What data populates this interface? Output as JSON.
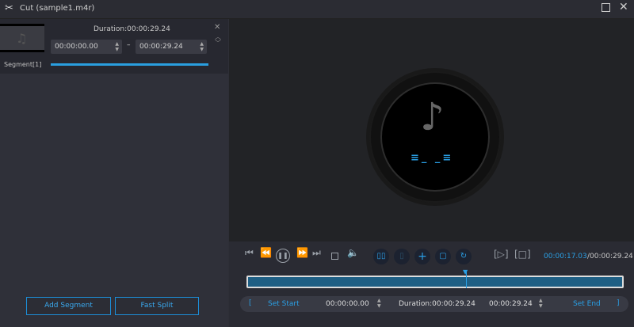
{
  "window": {
    "title": "Cut (sample1.m4r)"
  },
  "segment": {
    "duration": "Duration:00:00:29.24",
    "start": "00:00:00.00",
    "end": "00:00:29.24",
    "dash": "–",
    "label": "Segment[1]"
  },
  "left_buttons": {
    "add_segment": "Add Segment",
    "fast_split": "Fast Split"
  },
  "player": {
    "current_time": "00:00:17.03",
    "total_time": "/00:00:29.24",
    "progress_fraction": 0.5825
  },
  "bottom_bar": {
    "set_start": "Set Start",
    "start_time": "00:00:00.00",
    "duration": "Duration:00:00:29.24",
    "end_time": "00:00:29.24",
    "set_end": "Set End",
    "bracket_open": "[",
    "bracket_close": "]"
  },
  "colors": {
    "accent": "#1c8ed8",
    "timeline": "#1f5f84"
  }
}
